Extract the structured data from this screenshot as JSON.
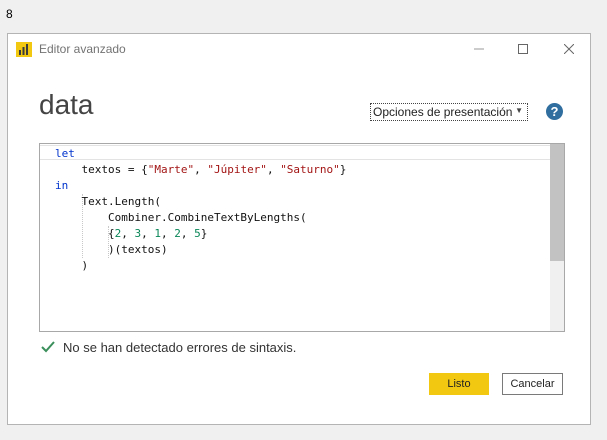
{
  "outer": {
    "label": "8"
  },
  "titlebar": {
    "title": "Editor avanzado",
    "icons": {
      "app": "power-bi-icon",
      "minimize": "minimize-icon",
      "maximize": "maximize-icon",
      "close": "close-icon"
    }
  },
  "query": {
    "name": "data"
  },
  "toolbar": {
    "options_label": "Opciones de presentación",
    "help_label": "?"
  },
  "code": {
    "lines": [
      [
        {
          "t": "let",
          "c": "kw"
        }
      ],
      [
        {
          "t": "    textos = {"
        },
        {
          "t": "\"Marte\"",
          "c": "str"
        },
        {
          "t": ", "
        },
        {
          "t": "\"Júpiter\"",
          "c": "str"
        },
        {
          "t": ", "
        },
        {
          "t": "\"Saturno\"",
          "c": "str"
        },
        {
          "t": "}"
        }
      ],
      [
        {
          "t": "in",
          "c": "kw"
        }
      ],
      [
        {
          "t": "    Text.Length("
        }
      ],
      [
        {
          "t": "        Combiner.CombineTextByLengths("
        }
      ],
      [
        {
          "t": "        {"
        },
        {
          "t": "2",
          "c": "num"
        },
        {
          "t": ", "
        },
        {
          "t": "3",
          "c": "num"
        },
        {
          "t": ", "
        },
        {
          "t": "1",
          "c": "num"
        },
        {
          "t": ", "
        },
        {
          "t": "2",
          "c": "num"
        },
        {
          "t": ", "
        },
        {
          "t": "5",
          "c": "num"
        },
        {
          "t": "}"
        }
      ],
      [
        {
          "t": "        )(textos)"
        }
      ],
      [
        {
          "t": "    )"
        }
      ]
    ]
  },
  "status": {
    "icon": "check-icon",
    "text": "No se han detectado errores de sintaxis."
  },
  "buttons": {
    "ok_label": "Listo",
    "cancel_label": "Cancelar"
  },
  "colors": {
    "accent": "#f2c811",
    "help": "#2f6e9f",
    "keyword": "#0033cc",
    "string": "#a31515",
    "number": "#098658"
  }
}
